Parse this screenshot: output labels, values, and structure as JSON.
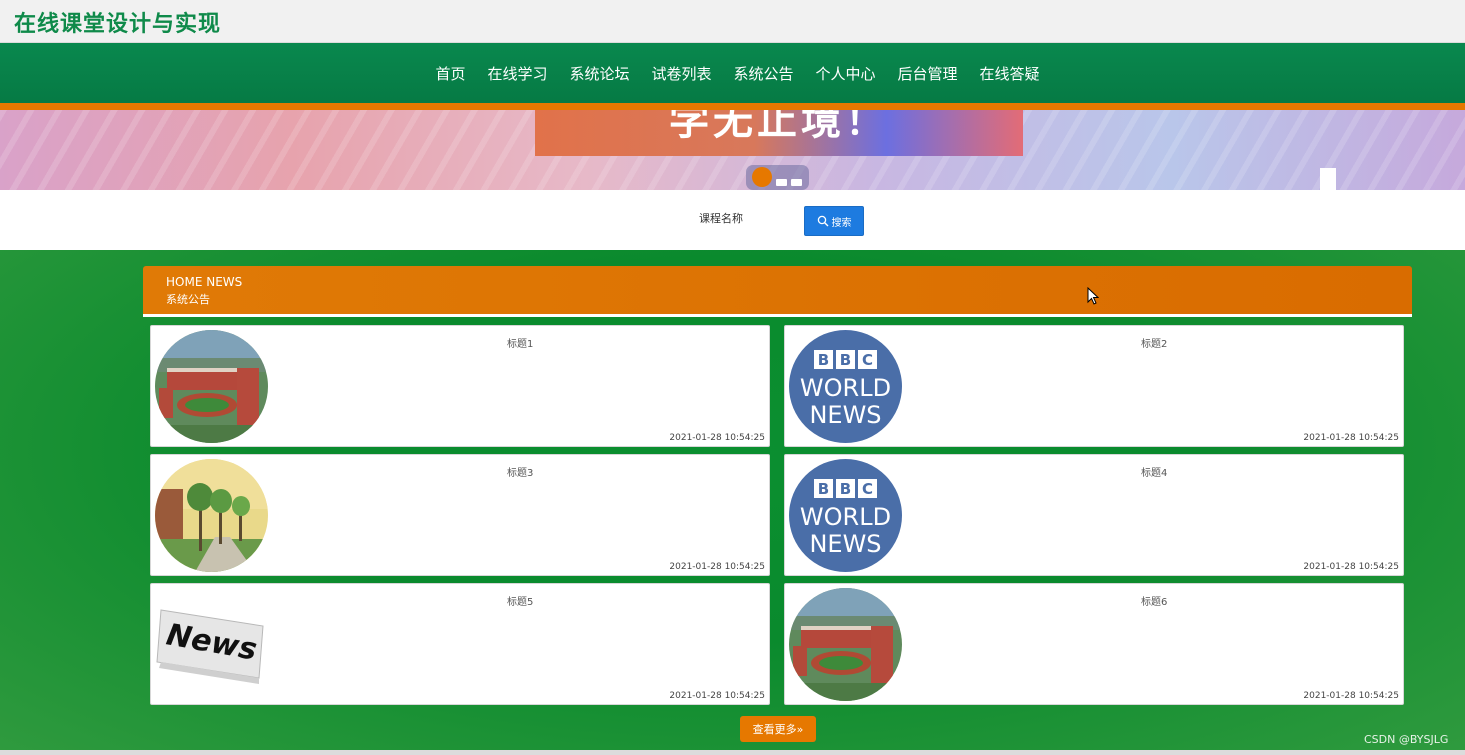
{
  "header": {
    "site_title": "在线课堂设计与实现"
  },
  "nav": {
    "items": [
      "首页",
      "在线学习",
      "系统论坛",
      "试卷列表",
      "系统公告",
      "个人中心",
      "后台管理",
      "在线答疑"
    ]
  },
  "banner": {
    "text": "学无止境！",
    "slide_count": 3,
    "active_slide": 1
  },
  "search": {
    "label": "课程名称",
    "button_label": "搜索"
  },
  "news": {
    "heading_en": "HOME NEWS",
    "heading_cn": "系统公告",
    "items": [
      {
        "title": "标题1",
        "date": "2021-01-28 10:54:25",
        "image": "campus"
      },
      {
        "title": "标题2",
        "date": "2021-01-28 10:54:25",
        "image": "bbc"
      },
      {
        "title": "标题3",
        "date": "2021-01-28 10:54:25",
        "image": "trees"
      },
      {
        "title": "标题4",
        "date": "2021-01-28 10:54:25",
        "image": "bbc"
      },
      {
        "title": "标题5",
        "date": "2021-01-28 10:54:25",
        "image": "newspaper"
      },
      {
        "title": "标题6",
        "date": "2021-01-28 10:54:25",
        "image": "campus"
      }
    ],
    "more_label": "查看更多»"
  },
  "watermark": "CSDN @BYSJLG",
  "colors": {
    "nav_green": "#09884e",
    "accent_orange": "#e67800",
    "section_green": "#0b8a2c",
    "button_blue": "#1d7be0"
  }
}
